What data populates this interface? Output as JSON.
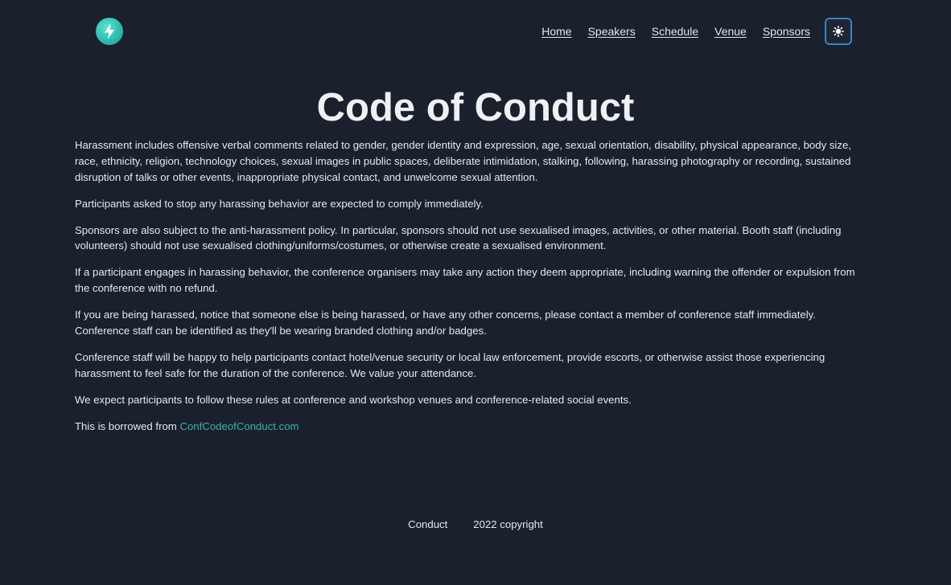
{
  "nav": {
    "items": [
      {
        "label": "Home"
      },
      {
        "label": "Speakers"
      },
      {
        "label": "Schedule"
      },
      {
        "label": "Venue"
      },
      {
        "label": "Sponsors"
      }
    ]
  },
  "icons": {
    "logo": "lightning-bolt-icon",
    "theme_toggle": "sun-icon"
  },
  "colors": {
    "background": "#1a202c",
    "accent": "#38b2ac",
    "focus_ring": "#3b82c4"
  },
  "page": {
    "title": "Code of Conduct",
    "paragraphs": [
      "Harassment includes offensive verbal comments related to gender, gender identity and expression, age, sexual orientation, disability, physical appearance, body size, race, ethnicity, religion, technology choices, sexual images in public spaces, deliberate intimidation, stalking, following, harassing photography or recording, sustained disruption of talks or other events, inappropriate physical contact, and unwelcome sexual attention.",
      "Participants asked to stop any harassing behavior are expected to comply immediately.",
      "Sponsors are also subject to the anti-harassment policy. In particular, sponsors should not use sexualised images, activities, or other material. Booth staff (including volunteers) should not use sexualised clothing/uniforms/costumes, or otherwise create a sexualised environment.",
      "If a participant engages in harassing behavior, the conference organisers may take any action they deem appropriate, including warning the offender or expulsion from the conference with no refund.",
      "If you are being harassed, notice that someone else is being harassed, or have any other concerns, please contact a member of conference staff immediately. Conference staff can be identified as they'll be wearing branded clothing and/or badges.",
      "Conference staff will be happy to help participants contact hotel/venue security or local law enforcement, provide escorts, or otherwise assist those experiencing harassment to feel safe for the duration of the conference. We value your attendance.",
      "We expect participants to follow these rules at conference and workshop venues and conference-related social events."
    ],
    "credit_prefix": "This is borrowed from ",
    "credit_link": "ConfCodeofConduct.com"
  },
  "footer": {
    "link": "Conduct",
    "copyright": "2022 copyright"
  }
}
